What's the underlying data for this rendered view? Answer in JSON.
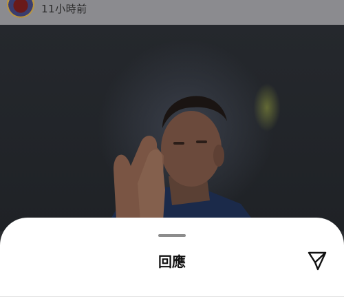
{
  "post": {
    "timestamp": "11小時前"
  },
  "sheet": {
    "title": "回應"
  },
  "icons": {
    "avatar": "club-crest-avatar",
    "send": "send-paper-plane-icon"
  },
  "colors": {
    "sheet_background": "#ffffff",
    "dim_overlay": "#8b8b8f",
    "grabber": "#8c8c8c"
  }
}
